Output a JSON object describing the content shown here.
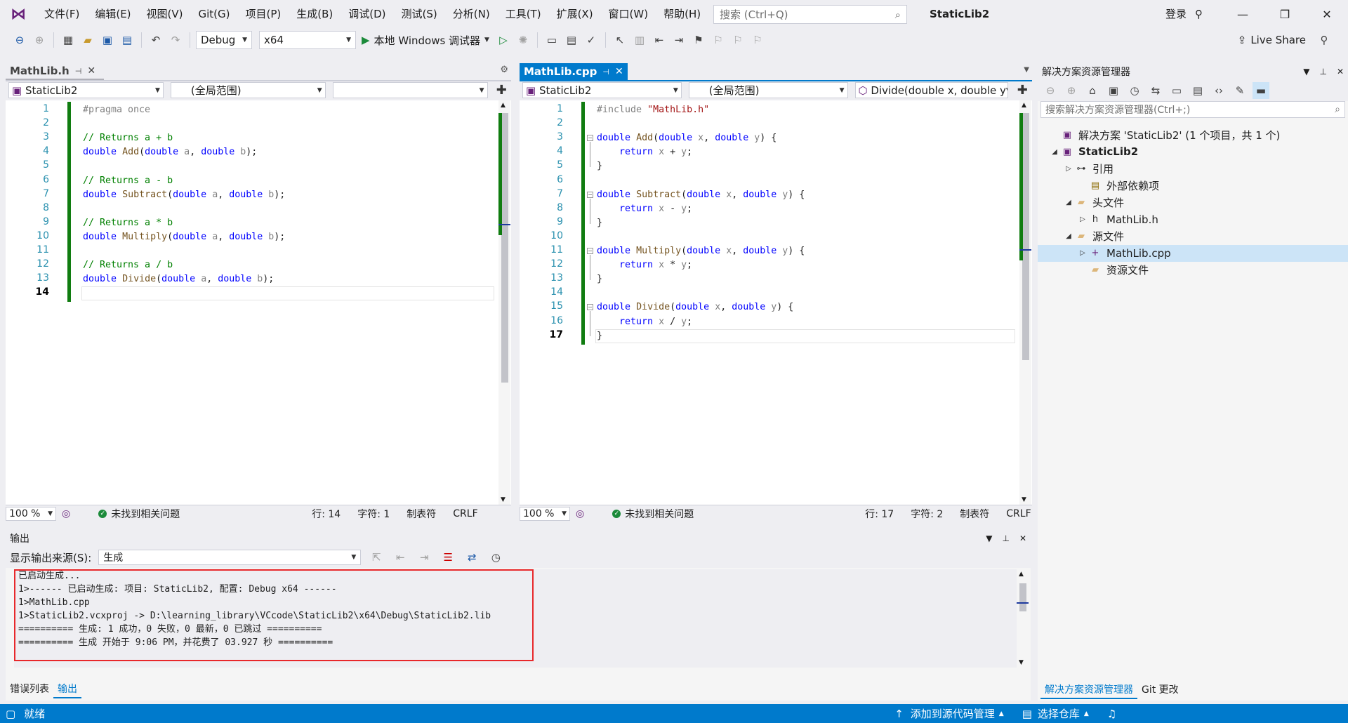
{
  "menu": [
    "文件(F)",
    "编辑(E)",
    "视图(V)",
    "Git(G)",
    "项目(P)",
    "生成(B)",
    "调试(D)",
    "测试(S)",
    "分析(N)",
    "工具(T)",
    "扩展(X)",
    "窗口(W)",
    "帮助(H)"
  ],
  "search": {
    "placeholder": "搜索 (Ctrl+Q)"
  },
  "window_title": "StaticLib2",
  "login_label": "登录",
  "toolbar": {
    "config": "Debug",
    "platform": "x64",
    "run_label": "本地 Windows 调试器",
    "liveshare_label": "Live Share"
  },
  "left_editor": {
    "tab_label": "MathLib.h",
    "project_combo": "StaticLib2",
    "scope_combo": "(全局范围)",
    "member_combo": "",
    "current_line": 14,
    "lines": [
      {
        "n": "1",
        "html": "<span class='pp'>#pragma once</span>"
      },
      {
        "n": "2",
        "html": ""
      },
      {
        "n": "3",
        "html": "<span class='cm'>// Returns a + b</span>"
      },
      {
        "n": "4",
        "html": "<span class='kw'>double</span> <span class='fn'>Add</span>(<span class='kw'>double</span> <span class='prm'>a</span>, <span class='kw'>double</span> <span class='prm'>b</span>);"
      },
      {
        "n": "5",
        "html": ""
      },
      {
        "n": "6",
        "html": "<span class='cm'>// Returns a - b</span>"
      },
      {
        "n": "7",
        "html": "<span class='kw'>double</span> <span class='fn'>Subtract</span>(<span class='kw'>double</span> <span class='prm'>a</span>, <span class='kw'>double</span> <span class='prm'>b</span>);"
      },
      {
        "n": "8",
        "html": ""
      },
      {
        "n": "9",
        "html": "<span class='cm'>// Returns a * b</span>"
      },
      {
        "n": "10",
        "html": "<span class='kw'>double</span> <span class='fn'>Multiply</span>(<span class='kw'>double</span> <span class='prm'>a</span>, <span class='kw'>double</span> <span class='prm'>b</span>);"
      },
      {
        "n": "11",
        "html": ""
      },
      {
        "n": "12",
        "html": "<span class='cm'>// Returns a / b</span>"
      },
      {
        "n": "13",
        "html": "<span class='kw'>double</span> <span class='fn'>Divide</span>(<span class='kw'>double</span> <span class='prm'>a</span>, <span class='kw'>double</span> <span class='prm'>b</span>);"
      },
      {
        "n": "14",
        "html": ""
      }
    ],
    "zoom": "100 %",
    "issues": "未找到相关问题",
    "row": "行: 14",
    "col": "字符: 1",
    "tabs_mode": "制表符",
    "eol": "CRLF"
  },
  "right_editor": {
    "tab_label": "MathLib.cpp",
    "project_combo": "StaticLib2",
    "scope_combo": "(全局范围)",
    "member_combo": "Divide(double x, double y",
    "current_line": 17,
    "lines": [
      {
        "n": "1",
        "html": "<span class='pp'>#include </span><span class='str'>\"MathLib.h\"</span>"
      },
      {
        "n": "2",
        "html": ""
      },
      {
        "n": "3",
        "html": "<span class='kw'>double</span> <span class='fn'>Add</span>(<span class='kw'>double</span> <span class='prm'>x</span>, <span class='kw'>double</span> <span class='prm'>y</span>) {"
      },
      {
        "n": "4",
        "html": "    <span class='kw'>return</span> <span class='prm'>x</span> + <span class='prm'>y</span>;"
      },
      {
        "n": "5",
        "html": "}"
      },
      {
        "n": "6",
        "html": ""
      },
      {
        "n": "7",
        "html": "<span class='kw'>double</span> <span class='fn'>Subtract</span>(<span class='kw'>double</span> <span class='prm'>x</span>, <span class='kw'>double</span> <span class='prm'>y</span>) {"
      },
      {
        "n": "8",
        "html": "    <span class='kw'>return</span> <span class='prm'>x</span> - <span class='prm'>y</span>;"
      },
      {
        "n": "9",
        "html": "}"
      },
      {
        "n": "10",
        "html": ""
      },
      {
        "n": "11",
        "html": "<span class='kw'>double</span> <span class='fn'>Multiply</span>(<span class='kw'>double</span> <span class='prm'>x</span>, <span class='kw'>double</span> <span class='prm'>y</span>) {"
      },
      {
        "n": "12",
        "html": "    <span class='kw'>return</span> <span class='prm'>x</span> * <span class='prm'>y</span>;"
      },
      {
        "n": "13",
        "html": "}"
      },
      {
        "n": "14",
        "html": ""
      },
      {
        "n": "15",
        "html": "<span class='kw'>double</span> <span class='fn'>Divide</span>(<span class='kw'>double</span> <span class='prm'>x</span>, <span class='kw'>double</span> <span class='prm'>y</span>) {"
      },
      {
        "n": "16",
        "html": "    <span class='kw'>return</span> <span class='prm'>x</span> / <span class='prm'>y</span>;"
      },
      {
        "n": "17",
        "html": "}"
      }
    ],
    "zoom": "100 %",
    "issues": "未找到相关问题",
    "row": "行: 17",
    "col": "字符: 2",
    "tabs_mode": "制表符",
    "eol": "CRLF"
  },
  "solution_explorer": {
    "title": "解决方案资源管理器",
    "search_placeholder": "搜索解决方案资源管理器(Ctrl+;)",
    "tree": [
      {
        "label": "解决方案 'StaticLib2' (1 个项目，共 1 个)",
        "arrow": "",
        "icon": "solution-icon",
        "glyph": "▣",
        "color": "#68217a"
      },
      {
        "label": "StaticLib2",
        "arrow": "◢",
        "icon": "project-icon",
        "glyph": "▣",
        "color": "#68217a",
        "bold": true
      },
      {
        "label": "引用",
        "arrow": "▷",
        "icon": "references-icon",
        "glyph": "⊶",
        "color": "#333333"
      },
      {
        "label": "外部依赖项",
        "arrow": "",
        "icon": "external-deps-icon",
        "glyph": "▤",
        "color": "#8a6a00"
      },
      {
        "label": "头文件",
        "arrow": "◢",
        "icon": "folder-icon",
        "glyph": "▰",
        "color": "#dcb67a"
      },
      {
        "label": "MathLib.h",
        "arrow": "▷",
        "icon": "header-file-icon",
        "glyph": "h",
        "color": "#333333"
      },
      {
        "label": "源文件",
        "arrow": "◢",
        "icon": "folder-icon",
        "glyph": "▰",
        "color": "#dcb67a"
      },
      {
        "label": "MathLib.cpp",
        "arrow": "▷",
        "icon": "cpp-file-icon",
        "glyph": "+",
        "color": "#68217a",
        "selected": true
      },
      {
        "label": "资源文件",
        "arrow": "",
        "icon": "folder-icon",
        "glyph": "▰",
        "color": "#dcb67a"
      }
    ],
    "bottom_tabs": [
      "解决方案资源管理器",
      "Git 更改"
    ]
  },
  "output": {
    "title": "输出",
    "source_label": "显示输出来源(S):",
    "source_value": "生成",
    "lines": [
      "已启动生成...",
      "1>------ 已启动生成: 项目: StaticLib2, 配置: Debug x64 ------",
      "1>MathLib.cpp",
      "1>StaticLib2.vcxproj -> D:\\learning_library\\VCcode\\StaticLib2\\x64\\Debug\\StaticLib2.lib",
      "========== 生成: 1 成功，0 失败，0 最新，0 已跳过 ==========",
      "========== 生成 开始于 9:06 PM，并花费了 03.927 秒 =========="
    ],
    "bottom_tabs": [
      "错误列表",
      "输出"
    ]
  },
  "statusbar": {
    "ready": "就绪",
    "add_source": "添加到源代码管理",
    "select_repo": "选择仓库"
  }
}
